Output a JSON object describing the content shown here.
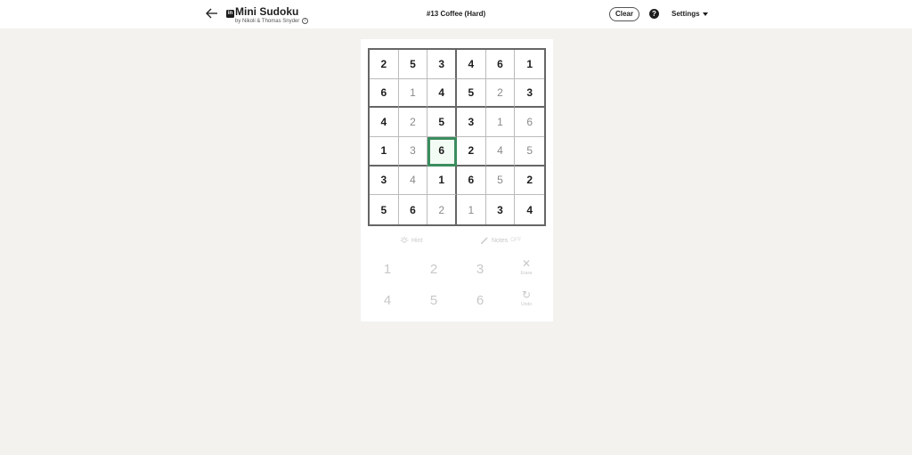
{
  "header": {
    "app_title": "Mini Sudoku",
    "byline": "by Nikoli & Thomas Snyder",
    "puzzle_title": "#13 Coffee (Hard)",
    "clear_label": "Clear",
    "help_label": "?",
    "settings_label": "Settings",
    "logo_text": "in"
  },
  "board": {
    "size": 6,
    "selected": [
      3,
      2
    ],
    "accent_color": "#3a8d5e",
    "rows": [
      [
        {
          "v": "2",
          "given": true
        },
        {
          "v": "5",
          "given": true
        },
        {
          "v": "3",
          "given": true
        },
        {
          "v": "4",
          "given": true
        },
        {
          "v": "6",
          "given": true
        },
        {
          "v": "1",
          "given": true
        }
      ],
      [
        {
          "v": "6",
          "given": true
        },
        {
          "v": "1",
          "given": false
        },
        {
          "v": "4",
          "given": true
        },
        {
          "v": "5",
          "given": true
        },
        {
          "v": "2",
          "given": false
        },
        {
          "v": "3",
          "given": true
        }
      ],
      [
        {
          "v": "4",
          "given": true
        },
        {
          "v": "2",
          "given": false
        },
        {
          "v": "5",
          "given": true
        },
        {
          "v": "3",
          "given": true
        },
        {
          "v": "1",
          "given": false
        },
        {
          "v": "6",
          "given": false
        }
      ],
      [
        {
          "v": "1",
          "given": true
        },
        {
          "v": "3",
          "given": false
        },
        {
          "v": "6",
          "given": true
        },
        {
          "v": "2",
          "given": true
        },
        {
          "v": "4",
          "given": false
        },
        {
          "v": "5",
          "given": false
        }
      ],
      [
        {
          "v": "3",
          "given": true
        },
        {
          "v": "4",
          "given": false
        },
        {
          "v": "1",
          "given": true
        },
        {
          "v": "6",
          "given": true
        },
        {
          "v": "5",
          "given": false
        },
        {
          "v": "2",
          "given": true
        }
      ],
      [
        {
          "v": "5",
          "given": true
        },
        {
          "v": "6",
          "given": true
        },
        {
          "v": "2",
          "given": false
        },
        {
          "v": "1",
          "given": false
        },
        {
          "v": "3",
          "given": true
        },
        {
          "v": "4",
          "given": true
        }
      ]
    ]
  },
  "tools": {
    "hint_label": "Hint",
    "notes_label": "Notes",
    "notes_state": "OFF"
  },
  "numpad": {
    "keys": [
      "1",
      "2",
      "3",
      "4",
      "5",
      "6"
    ],
    "erase_label": "Erase",
    "undo_label": "Undo"
  },
  "icons": {
    "back": "arrow-left-icon",
    "info": "info-icon",
    "help": "question-circle-icon",
    "hint": "lightbulb-icon",
    "notes": "pencil-icon",
    "erase": "close-icon",
    "undo": "undo-icon"
  }
}
